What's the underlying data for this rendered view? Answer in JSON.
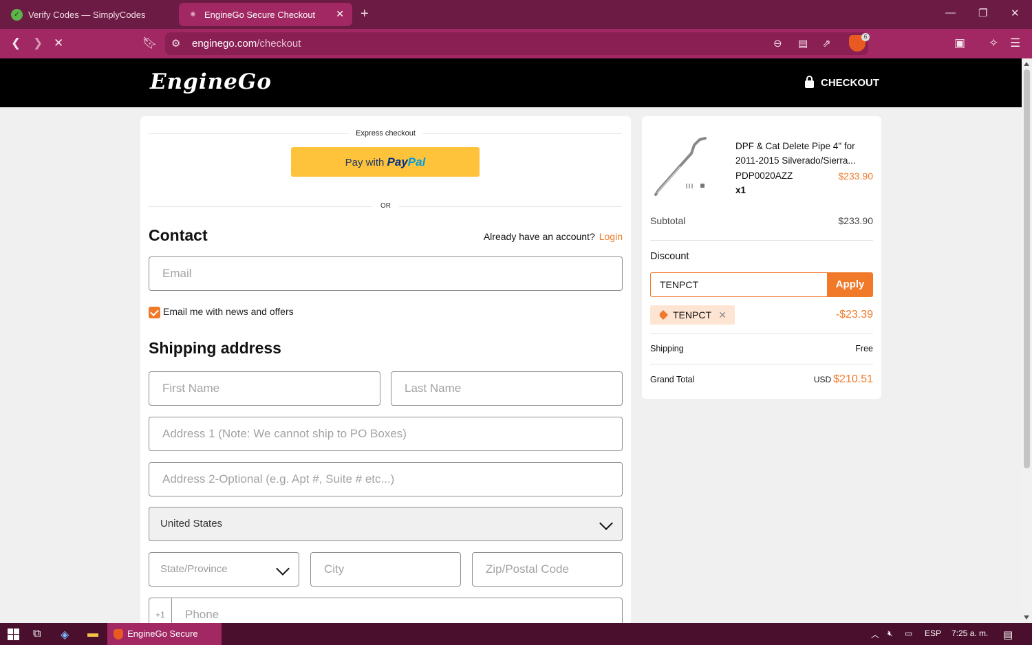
{
  "browser": {
    "tabs": [
      {
        "label": "Verify Codes — SimplyCodes",
        "active": false
      },
      {
        "label": "EngineGo Secure Checkout",
        "active": true
      }
    ],
    "url_domain": "enginego.com",
    "url_path": "/checkout",
    "shield_count": "6"
  },
  "header": {
    "logo": "EngineGo",
    "checkout_label": "CHECKOUT"
  },
  "express": {
    "label": "Express checkout",
    "paypal_prefix": "Pay with",
    "paypal_brand_1": "Pay",
    "paypal_brand_2": "Pal",
    "or_label": "OR"
  },
  "contact": {
    "title": "Contact",
    "account_prompt": "Already have an account?",
    "login_label": "Login",
    "email_placeholder": "Email",
    "newsletter_label": "Email me with news and offers",
    "newsletter_checked": true
  },
  "shipping": {
    "title": "Shipping address",
    "first_name_placeholder": "First Name",
    "last_name_placeholder": "Last Name",
    "address1_placeholder": "Address 1 (Note: We cannot ship to PO Boxes)",
    "address2_placeholder": "Address 2-Optional (e.g. Apt #, Suite # etc...)",
    "country_value": "United States",
    "state_placeholder": "State/Province",
    "city_placeholder": "City",
    "zip_placeholder": "Zip/Postal Code",
    "phone_prefix": "+1",
    "phone_placeholder": "Phone"
  },
  "summary": {
    "product_name": "DPF & Cat Delete Pipe 4\" for 2011-2015 Silverado/Sierra...",
    "product_sku": "PDP0020AZZ",
    "product_price": "$233.90",
    "product_qty": "x1",
    "subtotal_label": "Subtotal",
    "subtotal_value": "$233.90",
    "discount_title": "Discount",
    "discount_input_value": "TENPCT",
    "apply_label": "Apply",
    "applied_code": "TENPCT",
    "discount_amount": "-$23.39",
    "shipping_label": "Shipping",
    "shipping_value": "Free",
    "grand_total_label": "Grand Total",
    "currency": "USD",
    "grand_total_value": "$210.51"
  },
  "taskbar": {
    "app_label": "EngineGo Secure Che...",
    "language": "ESP",
    "time": "7:25 a. m."
  },
  "colors": {
    "accent": "#f07a2a",
    "browser_chrome": "#a12862",
    "paypal_yellow": "#fec33a"
  }
}
